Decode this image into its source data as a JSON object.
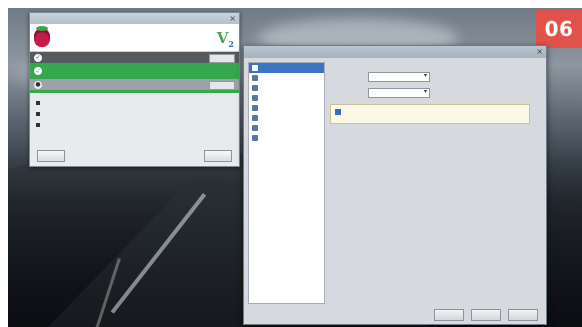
{
  "badge": {
    "label": "06",
    "color": "#e0524a"
  },
  "pia_window": {
    "title": "",
    "header_title": "",
    "header_subtitle": "",
    "brand_logo_text": "VP",
    "status_rows": [
      {
        "text": "",
        "button": "",
        "state": "dark"
      },
      {
        "text": "",
        "button": "",
        "state": "green"
      },
      {
        "text": "",
        "button": "",
        "state": "gray"
      }
    ],
    "menu_items": [
      {
        "label": ""
      },
      {
        "label": ""
      },
      {
        "label": ""
      }
    ],
    "buttons": {
      "left": "",
      "right": ""
    },
    "accent": "#35a74c"
  },
  "pref_window": {
    "title": "",
    "categories": [
      {
        "label": "",
        "selected": true
      },
      {
        "label": "",
        "selected": false
      },
      {
        "label": "",
        "selected": false
      },
      {
        "label": "",
        "selected": false
      },
      {
        "label": "",
        "selected": false
      },
      {
        "label": "",
        "selected": false
      },
      {
        "label": "",
        "selected": false
      },
      {
        "label": "",
        "selected": false
      }
    ],
    "settings": [
      {
        "label": "",
        "value": ""
      },
      {
        "label": "",
        "value": ""
      }
    ],
    "info_text": "",
    "buttons": {
      "left": "",
      "middle": "",
      "right": ""
    },
    "selection_color": "#3d73c7"
  }
}
